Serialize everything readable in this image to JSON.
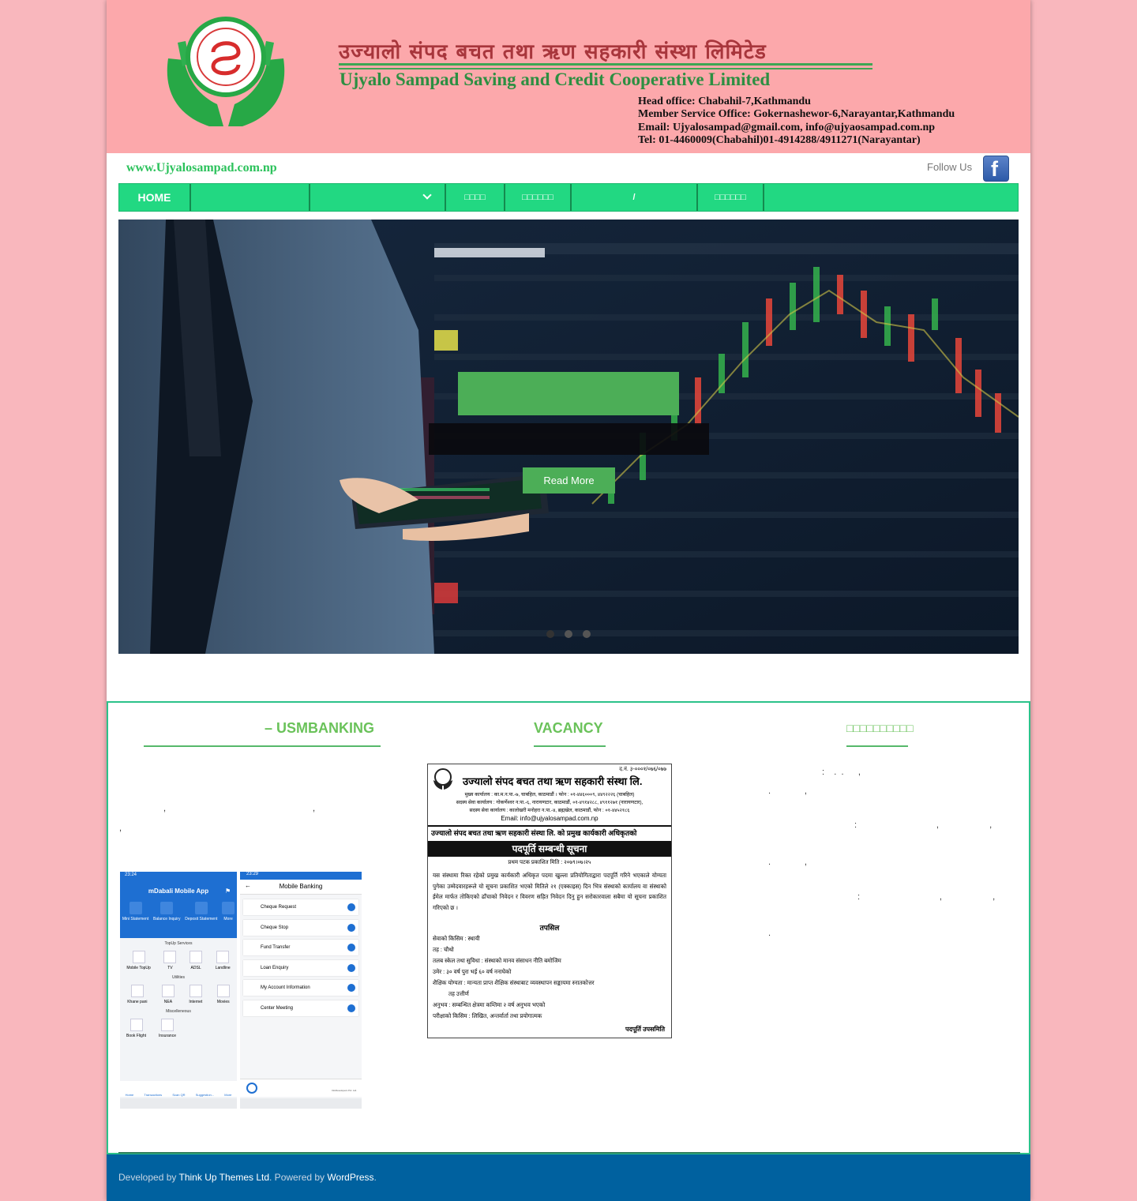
{
  "header": {
    "title_np": "उज्यालो संपद बचत तथा ऋण सहकारी संस्था लिमिटेड",
    "title_en": "Ujyalo Sampad Saving and Credit Cooperative Limited",
    "head_office": "Head office: Chabahil-7,Kathmandu",
    "member_office": "Member Service Office: Gokernashewor-6,Narayantar,Kathmandu",
    "email": "Email: Ujyalosampad@gmail.com, info@ujyaosampad.com.np",
    "tel": "Tel: 01-4460009(Chabahil)01-4914288/4911271(Narayantar)",
    "brand_color": "#fca8ab"
  },
  "topbar": {
    "url": "www.Ujyalosampad.com.np",
    "follow_label": "Follow Us",
    "facebook_glyph": "f"
  },
  "nav": {
    "items": [
      {
        "label": "HOME"
      },
      {
        "label": ""
      },
      {
        "label": "",
        "has_dropdown": true
      },
      {
        "label": "□□□□"
      },
      {
        "label": "□□□□□□"
      },
      {
        "label": "/"
      },
      {
        "label": "□□□□□□"
      }
    ],
    "accent_color": "#22d882"
  },
  "slider": {
    "read_more": "Read More",
    "slide_count": 3,
    "active_slide": 1
  },
  "widgets": {
    "mbanking_title": "– USMBANKING",
    "vacancy_title": "VACANCY",
    "notice_title": "□□□□□□□□□□",
    "phone1": {
      "title": "mDabali Mobile App",
      "time": "23:24",
      "quick": [
        "Mini Statement",
        "Balance Inquiry",
        "Deposit Statement",
        "More"
      ],
      "topup_label": "TopUp Services",
      "topup": [
        "Mobile TopUp",
        "TV",
        "ADSL",
        "Landline"
      ],
      "utilities_label": "Utilities",
      "utilities": [
        "Khane pani",
        "NEA",
        "Internet",
        "Movies"
      ],
      "misc_label": "Miscelleneous",
      "misc": [
        "Book Flight",
        "Insurance"
      ],
      "bottom": [
        "Home",
        "Transactions",
        "Scan QR",
        "Suggestion...",
        "More"
      ]
    },
    "phone2": {
      "title": "Mobile Banking",
      "time": "23:29",
      "items": [
        "Cheque Request",
        "Cheque Stop",
        "Fund Transfer",
        "Loan Enquiry",
        "My Account Information",
        "Center Meeting"
      ],
      "footer": "InfoDevelopers Pvt. Ltd."
    },
    "vacancy": {
      "ref": "द.नं. ३-०००१/०७६/०७७",
      "org": "उज्यालो संपद बचत तथा ऋण सहकारी संस्था लि.",
      "address1": "मुख्य कार्यालय : का.म.न.पा.-७, चाबहिल, काठमाडौं । फोन : ०१-४४६०००९, ४४९२२२६ (चाबहिल)",
      "address2": "सदस्य सेवा कार्यालय : गोकर्णेश्वर न.पा.-६, नारायणटार, काठमाडौं, ०१-४९१४२८८, ४९११२७१ (नारायणटार),",
      "address3": "सदस्य सेवा कार्यालय : कालोखरी मनोहरा न.पा.-४, ब्रह्मखेल, काठमाडौं, फोन : ०१-४४५२१८६",
      "email": "Email: info@ujyalosampad.com.np",
      "heading": "उज्यालो संपद बचत तथा ऋण सहकारी संस्था लि. को प्रमुख कार्यकारी अधिकृतको",
      "banner": "पदपूर्ति सम्बन्धी सूचना",
      "date": "प्रथम पटक प्रकाशित मिति : २०७९।०७।२५",
      "body": "यस संस्थामा रिक्त रहेको प्रमुख कार्यकारी अधिकृत पदमा खुल्ला प्रतियोगिताद्वारा पदपूर्ति गरिने भएकाले योग्यता पुगेका उम्मेदवारहरूले यो सूचना प्रकाशित भएको मितिले २१ (एक्काइस) दिन भित्र संस्थाको कार्यालय वा संस्थाको ईमेल मार्फत तोकिएको ढाँचाको निवेदन र विवरण सहित निवेदन दिनु हुन सरोकारवाला सबैमा यो सूचना प्रकाशित गरिएको छ ।",
      "subhead": "तपसिल",
      "details": [
        "सेवाको किसिम : स्थायी",
        "तह : चौथो",
        "तलब स्केल तथा सुविधा : संस्थाको मानव संसाधन नीति बमोजिम",
        "उमेर : ३० वर्ष पुरा भई ६० वर्ष ननाघेको",
        "शैक्षिक योग्यता : मान्यता प्राप्त शैक्षिक संस्थाबाट व्यवस्थापन सङ्कायमा स्नातकोत्तर",
        "तह उत्तीर्ण",
        "अनुभव : सम्बन्धित क्षेत्रमा कम्तिमा २ वर्ष अनुभव भएको",
        "परीक्षाको किसिम : लिखित, अन्तर्वार्ता तथा प्रयोगात्मक"
      ],
      "signature": "पदपूर्ति उपसमिति"
    }
  },
  "footer": {
    "developed_by": "Developed by",
    "developer": "Think Up Themes Ltd",
    "powered_by": ". Powered by",
    "platform": "WordPress",
    "end": ".",
    "bg_color": "#00619f"
  }
}
